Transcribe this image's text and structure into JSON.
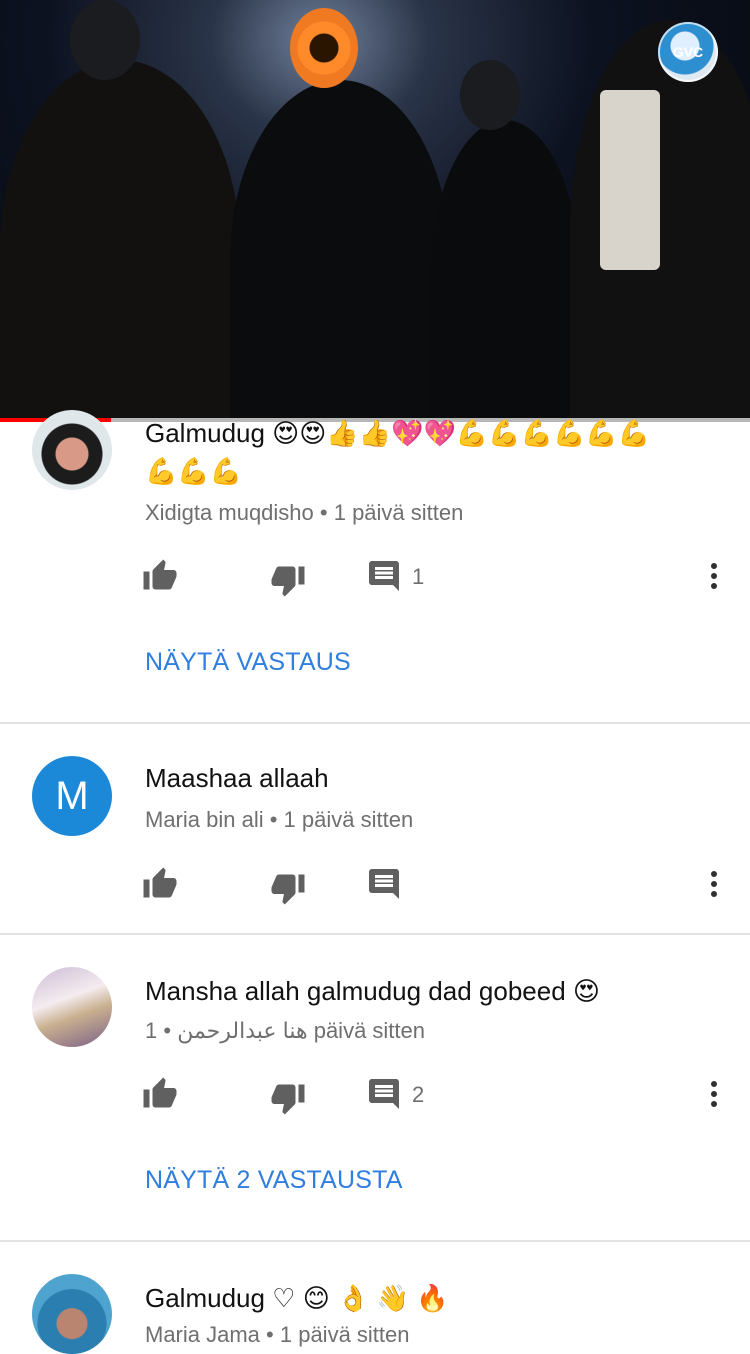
{
  "video": {
    "channel_badge_text": "GVC",
    "progress_fraction": 0.148
  },
  "comments": [
    {
      "text": "Galmudug 😍😍👍👍💖💖💪💪💪💪💪💪💪💪💪",
      "author": "Xidigta muqdisho",
      "time": "• 1 päivä sitten",
      "reply_count": "1",
      "replies_link": "NÄYTÄ VASTAUS"
    },
    {
      "avatar_letter": "M",
      "text": "Maashaa allaah",
      "author": "Maria bin ali",
      "time": "• 1 päivä sitten",
      "reply_count": ""
    },
    {
      "text": "Mansha allah galmudug dad gobeed 😍",
      "author": "هنا عبدالرحمن",
      "time": "• 1 päivä sitten",
      "reply_count": "2",
      "replies_link": "NÄYTÄ 2 VASTAUSTA"
    },
    {
      "text": "Galmudug ♡ 😊 👌 👋 🔥",
      "author": "Maria Jama",
      "time": "• 1 päivä sitten"
    }
  ],
  "colors": {
    "accent": "#2f7ee0",
    "progress": "#ff0000",
    "icon": "#606060"
  },
  "icons": {
    "like": "thumb-up-icon",
    "dislike": "thumb-down-icon",
    "reply": "comment-icon",
    "more": "more-vert-icon"
  }
}
